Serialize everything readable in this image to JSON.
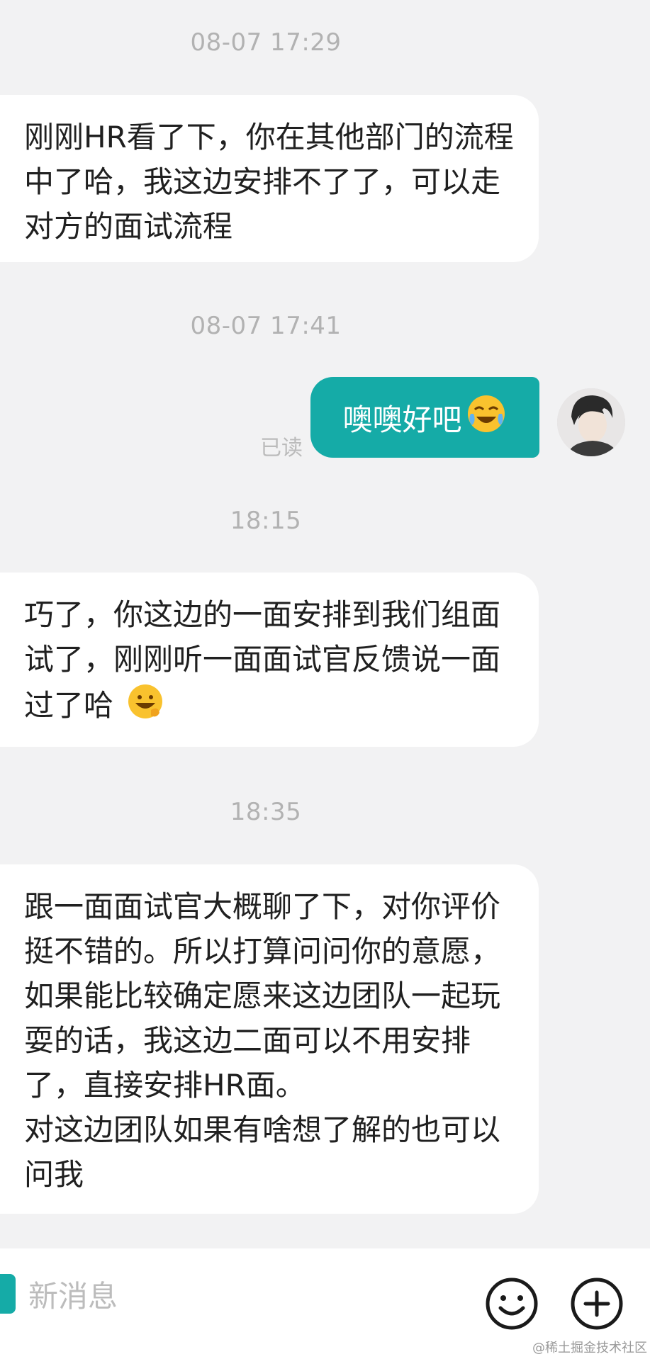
{
  "messages": {
    "ts1": "08-07 17:29",
    "m1": "刚刚HR看了下，你在其他部门的流程中了哈，我这边安排不了了，可以走对方的面试流程",
    "ts2": "08-07 17:41",
    "m2": "噢噢好吧",
    "m2_status": "已读",
    "ts3": "18:15",
    "m3": "巧了，你这边的一面安排到我们组面试了，刚刚听一面面试官反馈说一面过了哈",
    "ts4": "18:35",
    "m4_line1": "跟一面面试官大概聊了下，对你评价挺不错的。所以打算问问你的意愿，如果能比较确定愿来这边团队一起玩耍的话，我这边二面可以不用安排了，直接安排HR面。",
    "m4_line2": "对这边团队如果有啥想了解的也可以问我"
  },
  "input": {
    "placeholder": "新消息"
  },
  "icons": {
    "emoji_button": "smiley-icon",
    "add_button": "plus-circle-icon",
    "crying_emoji": "crying-laughing-emoji-icon",
    "happy_emoji": "happy-face-emoji-icon"
  },
  "colors": {
    "accent": "#15aba7",
    "background": "#f2f2f3",
    "bubble_in": "#ffffff",
    "timestamp": "#b2b2b2"
  },
  "watermark": "@稀土掘金技术社区"
}
